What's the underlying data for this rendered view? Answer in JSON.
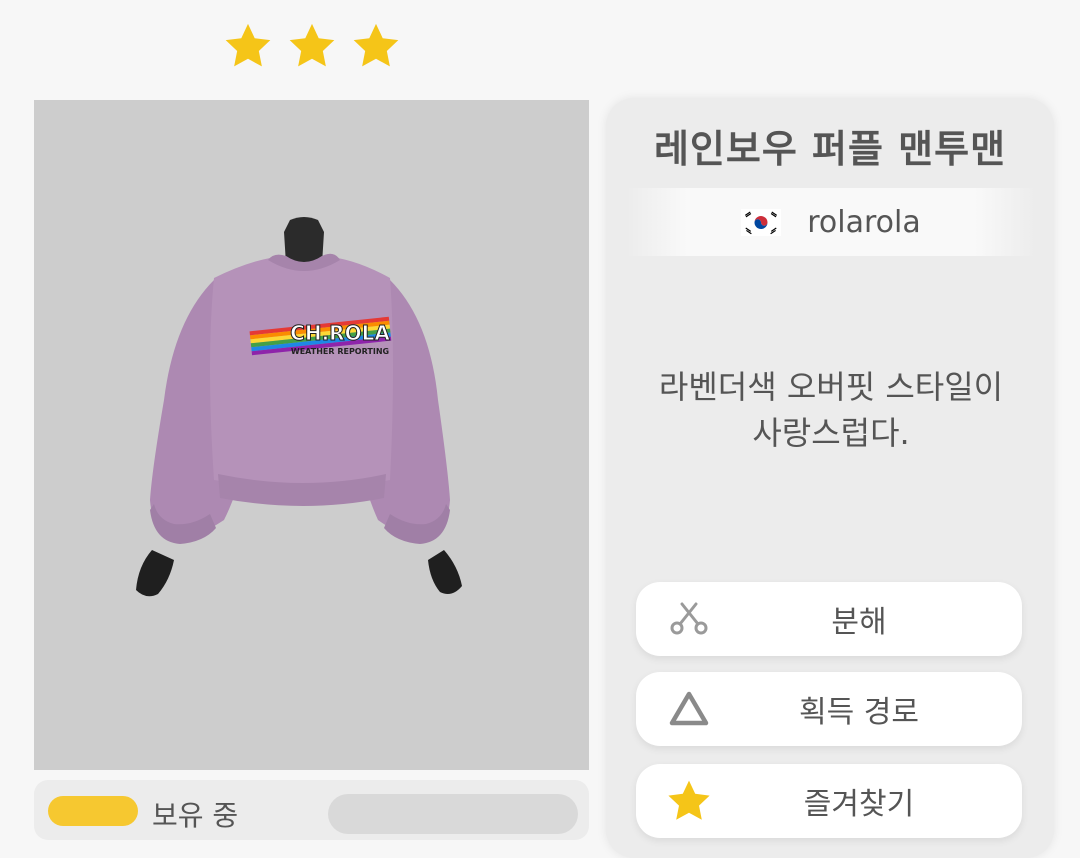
{
  "rating": {
    "stars": 3,
    "star_color": "#f5c518",
    "star_icon": "star-icon"
  },
  "preview": {
    "background": "#cdcdcd",
    "shirt_color": "#b592b9",
    "print_text": "CH.ROLA",
    "print_subtext": "WEATHER REPORTING"
  },
  "inventory": {
    "count_label": "",
    "owned_label": "보유 중",
    "accent_color": "#f6c830"
  },
  "item": {
    "title": "레인보우 퍼플 맨투맨",
    "creator": {
      "flag_icon": "korea-flag-icon",
      "name": "rolarola"
    },
    "description_line1": "라벤더색 오버핏 스타일이",
    "description_line2": "사랑스럽다."
  },
  "actions": [
    {
      "icon": "scissors-icon",
      "label": "분해"
    },
    {
      "icon": "triangle-icon",
      "label": "획득 경로"
    },
    {
      "icon": "star-icon",
      "label": "즐겨찾기"
    }
  ]
}
